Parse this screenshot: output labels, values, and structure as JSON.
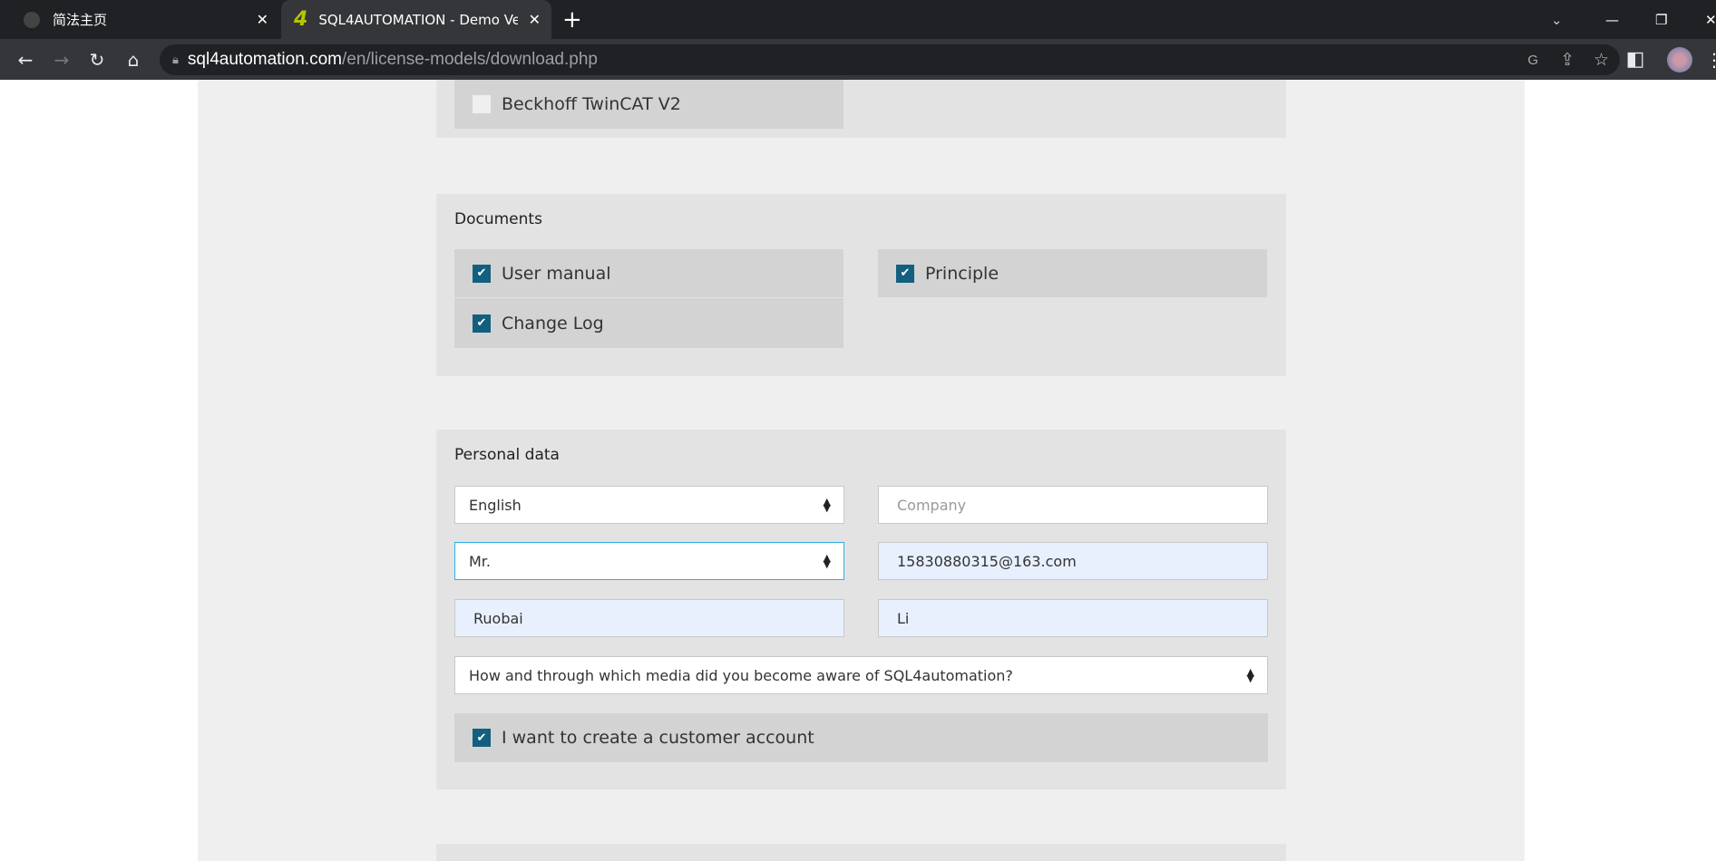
{
  "browser": {
    "tabs": [
      {
        "title": "简法主页",
        "active": false
      },
      {
        "title": "SQL4AUTOMATION - Demo Ve",
        "active": true
      }
    ],
    "url_host": "sql4automation.com",
    "url_path": "/en/license-models/download.php"
  },
  "form": {
    "plc_section": {
      "items": [
        {
          "label": "Beckhoff TwinCAT V2",
          "checked": false
        }
      ]
    },
    "documents": {
      "title": "Documents",
      "items": [
        {
          "label": "User manual",
          "checked": true
        },
        {
          "label": "Principle",
          "checked": true
        },
        {
          "label": "Change Log",
          "checked": true
        }
      ]
    },
    "personal": {
      "title": "Personal data",
      "language": "English",
      "company_placeholder": "Company",
      "salutation": "Mr.",
      "email": "15830880315@163.com",
      "first_name": "Ruobai",
      "last_name": "Li",
      "media_question": "How and through which media did you become aware of SQL4automation?",
      "create_account": {
        "label": "I want to create a customer account",
        "checked": true
      }
    }
  },
  "colors": {
    "checkbox": "#135f7f",
    "autofill": "#e8f0fe",
    "focus": "#2bb0e6"
  }
}
